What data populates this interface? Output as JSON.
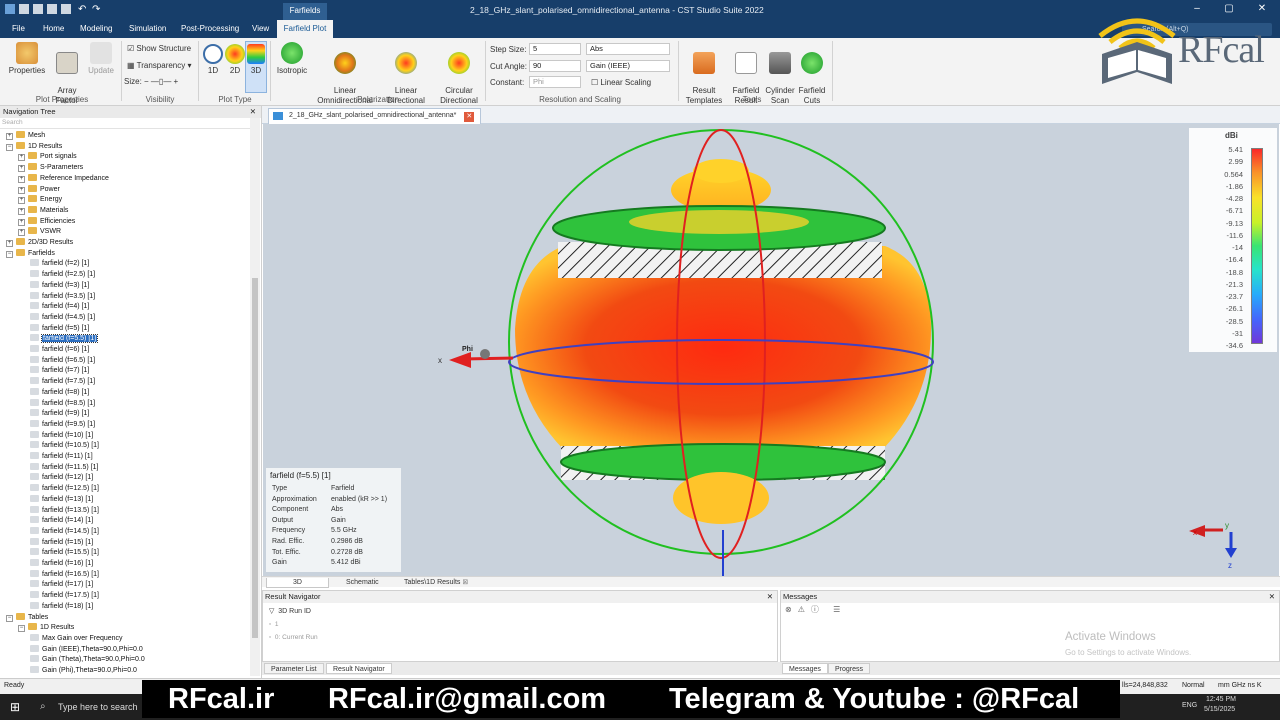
{
  "app": {
    "window_title": "2_18_GHz_slant_polarised_omnidirectional_antenna - CST Studio Suite 2022",
    "context_tab_group": "Farfields",
    "search_placeholder": "Search (Alt+Q)"
  },
  "menu": [
    "File",
    "Home",
    "Modeling",
    "Simulation",
    "Post-Processing",
    "View"
  ],
  "active_menu": "Farfield Plot",
  "ribbon": {
    "plot_properties": {
      "group": "Plot Properties",
      "items": [
        "Properties",
        "Array\nFactor",
        "Update"
      ]
    },
    "visibility": {
      "group": "Visibility",
      "show_structure": "Show Structure",
      "transparency": "Transparency",
      "size": "Size:"
    },
    "plot_type": {
      "group": "Plot Type",
      "items": [
        "1D",
        "2D",
        "3D"
      ]
    },
    "polarization": {
      "group": "Polarization",
      "items": [
        "Isotropic",
        "Linear\nOmnidirectional",
        "Linear\nDirectional",
        "Circular\nDirectional"
      ]
    },
    "resolution": {
      "group": "Resolution and Scaling",
      "step_size_label": "Step Size:",
      "step_size": "5",
      "cut_angle_label": "Cut Angle:",
      "cut_angle": "90",
      "constant_label": "Constant:",
      "constant": "Phi",
      "abs": "Abs",
      "gain": "Gain (IEEE)",
      "linear_scaling": "Linear Scaling"
    },
    "tools": {
      "group": "Tools",
      "items": [
        "Result\nTemplates",
        "Farfield\nResult",
        "Cylinder\nScan",
        "Farfield\nCuts"
      ]
    }
  },
  "nav": {
    "title": "Navigation Tree",
    "search": "Search",
    "items": [
      {
        "label": "Mesh",
        "level": 0,
        "exp": "+"
      },
      {
        "label": "1D Results",
        "level": 0,
        "exp": "-"
      },
      {
        "label": "Port signals",
        "level": 1,
        "exp": "+"
      },
      {
        "label": "S-Parameters",
        "level": 1,
        "exp": "+"
      },
      {
        "label": "Reference Impedance",
        "level": 1,
        "exp": "+"
      },
      {
        "label": "Power",
        "level": 1,
        "exp": "+"
      },
      {
        "label": "Energy",
        "level": 1,
        "exp": "+"
      },
      {
        "label": "Materials",
        "level": 1,
        "exp": "+"
      },
      {
        "label": "Efficiencies",
        "level": 1,
        "exp": "+"
      },
      {
        "label": "VSWR",
        "level": 1,
        "exp": "+"
      },
      {
        "label": "2D/3D Results",
        "level": 0,
        "exp": "+"
      },
      {
        "label": "Farfields",
        "level": 0,
        "exp": "-"
      },
      {
        "label": "farfield (f=2) [1]",
        "level": 2
      },
      {
        "label": "farfield (f=2.5) [1]",
        "level": 2
      },
      {
        "label": "farfield (f=3) [1]",
        "level": 2
      },
      {
        "label": "farfield (f=3.5) [1]",
        "level": 2
      },
      {
        "label": "farfield (f=4) [1]",
        "level": 2
      },
      {
        "label": "farfield (f=4.5) [1]",
        "level": 2
      },
      {
        "label": "farfield (f=5) [1]",
        "level": 2
      },
      {
        "label": "farfield (f=5.5) [1]",
        "level": 2,
        "selected": true
      },
      {
        "label": "farfield (f=6) [1]",
        "level": 2
      },
      {
        "label": "farfield (f=6.5) [1]",
        "level": 2
      },
      {
        "label": "farfield (f=7) [1]",
        "level": 2
      },
      {
        "label": "farfield (f=7.5) [1]",
        "level": 2
      },
      {
        "label": "farfield (f=8) [1]",
        "level": 2
      },
      {
        "label": "farfield (f=8.5) [1]",
        "level": 2
      },
      {
        "label": "farfield (f=9) [1]",
        "level": 2
      },
      {
        "label": "farfield (f=9.5) [1]",
        "level": 2
      },
      {
        "label": "farfield (f=10) [1]",
        "level": 2
      },
      {
        "label": "farfield (f=10.5) [1]",
        "level": 2
      },
      {
        "label": "farfield (f=11) [1]",
        "level": 2
      },
      {
        "label": "farfield (f=11.5) [1]",
        "level": 2
      },
      {
        "label": "farfield (f=12) [1]",
        "level": 2
      },
      {
        "label": "farfield (f=12.5) [1]",
        "level": 2
      },
      {
        "label": "farfield (f=13) [1]",
        "level": 2
      },
      {
        "label": "farfield (f=13.5) [1]",
        "level": 2
      },
      {
        "label": "farfield (f=14) [1]",
        "level": 2
      },
      {
        "label": "farfield (f=14.5) [1]",
        "level": 2
      },
      {
        "label": "farfield (f=15) [1]",
        "level": 2
      },
      {
        "label": "farfield (f=15.5) [1]",
        "level": 2
      },
      {
        "label": "farfield (f=16) [1]",
        "level": 2
      },
      {
        "label": "farfield (f=16.5) [1]",
        "level": 2
      },
      {
        "label": "farfield (f=17) [1]",
        "level": 2
      },
      {
        "label": "farfield (f=17.5) [1]",
        "level": 2
      },
      {
        "label": "farfield (f=18) [1]",
        "level": 2
      },
      {
        "label": "Tables",
        "level": 0,
        "exp": "-"
      },
      {
        "label": "1D Results",
        "level": 1,
        "exp": "-"
      },
      {
        "label": "Max Gain over Frequency",
        "level": 2
      },
      {
        "label": "Gain (IEEE),Theta=90.0,Phi=0.0",
        "level": 2
      },
      {
        "label": "Gain (Theta),Theta=90.0,Phi=0.0",
        "level": 2
      },
      {
        "label": "Gain (Phi),Theta=90.0,Phi=0.0",
        "level": 2
      }
    ]
  },
  "doc_tab": "2_18_GHz_slant_polarised_omnidirectional_antenna*",
  "legend": {
    "unit": "dBi",
    "values": [
      "5.41",
      "2.99",
      "0.564",
      "-1.86",
      "-4.28",
      "-6.71",
      "-9.13",
      "-11.6",
      "-14",
      "-16.4",
      "-18.8",
      "-21.3",
      "-23.7",
      "-26.1",
      "-28.5",
      "-31",
      "-34.6"
    ]
  },
  "axis_labels": {
    "phi": "Phi",
    "x": "x",
    "y": "y",
    "z": "z"
  },
  "info": {
    "title": "farfield (f=5.5) [1]",
    "rows": [
      {
        "k": "Type",
        "v": "Farfield"
      },
      {
        "k": "Approximation",
        "v": "enabled (kR >> 1)"
      },
      {
        "k": "Component",
        "v": "Abs"
      },
      {
        "k": "Output",
        "v": "Gain"
      },
      {
        "k": "Frequency",
        "v": "5.5 GHz"
      },
      {
        "k": "Rad. Effic.",
        "v": "0.2986 dB"
      },
      {
        "k": "Tot. Effic.",
        "v": "0.2728 dB"
      },
      {
        "k": "Gain",
        "v": "5.412 dBi"
      }
    ]
  },
  "view_tabs": [
    "3D",
    "Schematic",
    "Tables\\1D Results"
  ],
  "result_navigator": {
    "title": "Result Navigator",
    "col": "3D Run ID",
    "r1": "1",
    "r2": "0: Current Run"
  },
  "messages": {
    "title": "Messages"
  },
  "bottom_tabs_left": [
    "Parameter List",
    "Result Navigator"
  ],
  "bottom_tabs_right": [
    "Messages",
    "Progress"
  ],
  "status": {
    "left": "Ready",
    "cells": "lls=24,848,832",
    "mode": "Normal",
    "units": "mm  GHz  ns  K"
  },
  "watermark": {
    "line1": "Activate Windows",
    "line2": "Go to Settings to activate Windows."
  },
  "taskbar": {
    "search": "Type here to search",
    "lang": "ENG",
    "time": "12:45 PM",
    "date": "5/15/2025"
  },
  "banner": {
    "site": "RFcal.ir",
    "email": "RFcal.ir@gmail.com",
    "social": "Telegram & Youtube : @RFcal"
  },
  "logo": "RFcal"
}
